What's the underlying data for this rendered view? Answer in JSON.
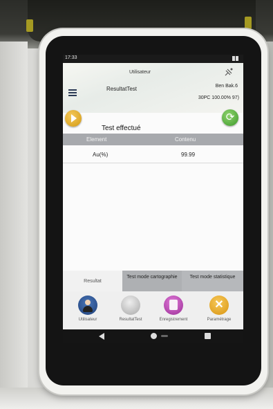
{
  "status_bar": {
    "time": "17:33"
  },
  "header": {
    "user_title": "Utilisateur",
    "result_title": "ResultatTest",
    "serial": "Ben Bak.6",
    "meta": "30PC 100.00% 97)"
  },
  "test_status": "Test effectué",
  "table": {
    "columns": [
      "Element",
      "Contenu"
    ],
    "rows": [
      {
        "element": "Au(%)",
        "contenu": "99.99"
      }
    ]
  },
  "tabs": [
    {
      "label": "Resultat",
      "active": true
    },
    {
      "label": "Test mode cartographie",
      "active": false
    },
    {
      "label": "Test mode statistique",
      "active": false
    }
  ],
  "bottom_nav": [
    {
      "label": "Utilisateur",
      "icon": "user-icon"
    },
    {
      "label": "ResultatTest",
      "icon": "result-icon"
    },
    {
      "label": "Enregistrement",
      "icon": "history-icon"
    },
    {
      "label": "Paramétrage",
      "icon": "settings-icon"
    }
  ],
  "colors": {
    "table_header": "#a7a9ad",
    "play_button": "#e0a21f",
    "refresh_button": "#4caf35",
    "tab_inactive": "#aeb0b3"
  }
}
